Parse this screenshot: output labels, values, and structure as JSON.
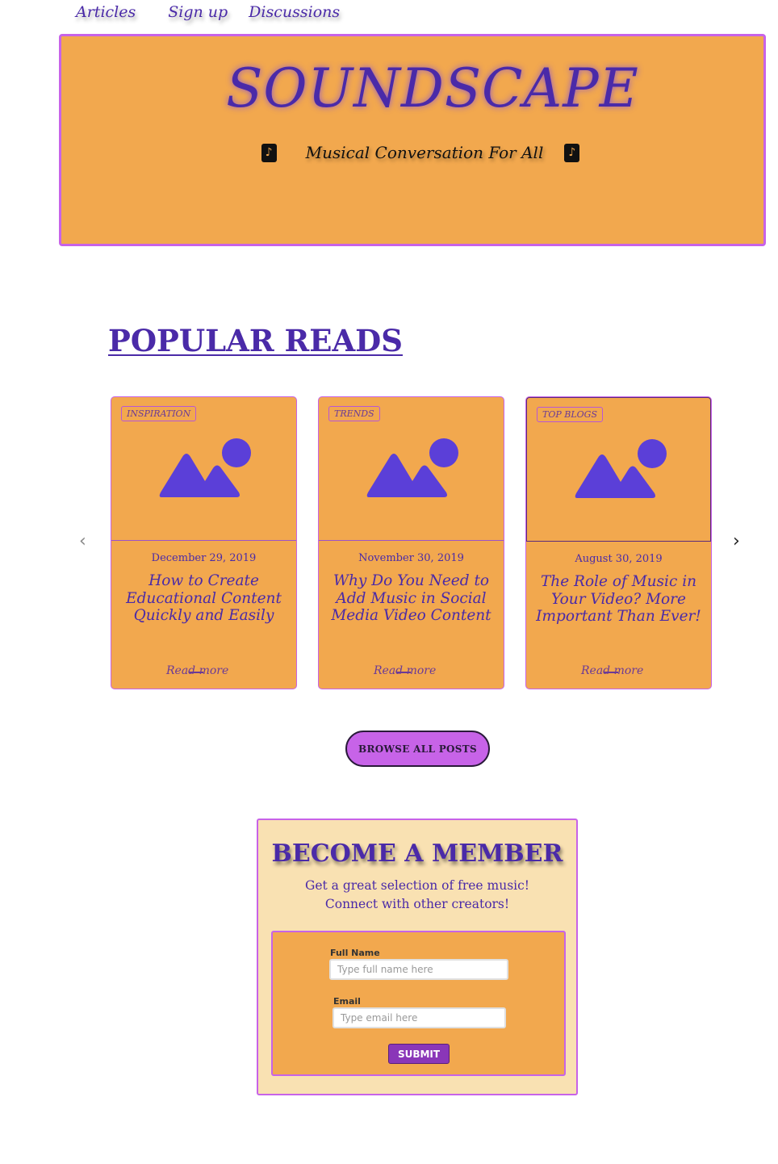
{
  "nav": {
    "items": [
      {
        "label": "Articles"
      },
      {
        "label": "Sign up"
      },
      {
        "label": "Discussions"
      }
    ]
  },
  "hero": {
    "title": "SOUNDSCAPE",
    "subtitle": "Musical Conversation For All",
    "icon": "music-note-icon"
  },
  "popular": {
    "title": "POPULAR READS",
    "cards": [
      {
        "tag": "INSPIRATION",
        "date": "December 29, 2019",
        "title": "How to Create Educational Content Quickly and Easily",
        "read_more": "Read more"
      },
      {
        "tag": "TRENDS",
        "date": "November 30, 2019",
        "title": "Why Do You Need to Add Music in Social Media Video Content",
        "read_more": "Read more"
      },
      {
        "tag": "TOP BLOGS",
        "date": "August 30, 2019",
        "title": "The Role of Music in Your Video?  More Important Than Ever!",
        "read_more": "Read more"
      }
    ],
    "prev_icon": "chevron-left-icon",
    "next_icon": "chevron-right-icon",
    "browse_label": "BROWSE ALL POSTS"
  },
  "member": {
    "title": "BECOME A MEMBER",
    "line1": "Get a great selection of free music!",
    "line2": "Connect with other creators!",
    "form": {
      "name_label": "Full Name",
      "name_placeholder": "Type full name here",
      "email_label": "Email",
      "email_placeholder": "Type email here",
      "submit_label": "SUBMIT"
    }
  },
  "colors": {
    "primary_orange": "#f2a84e",
    "accent_purple": "#4a2aa8",
    "border_violet": "#c763e8",
    "member_bg": "#f9e1b2",
    "submit_purple": "#8a36b8",
    "icon_purple": "#5b3fd8"
  }
}
